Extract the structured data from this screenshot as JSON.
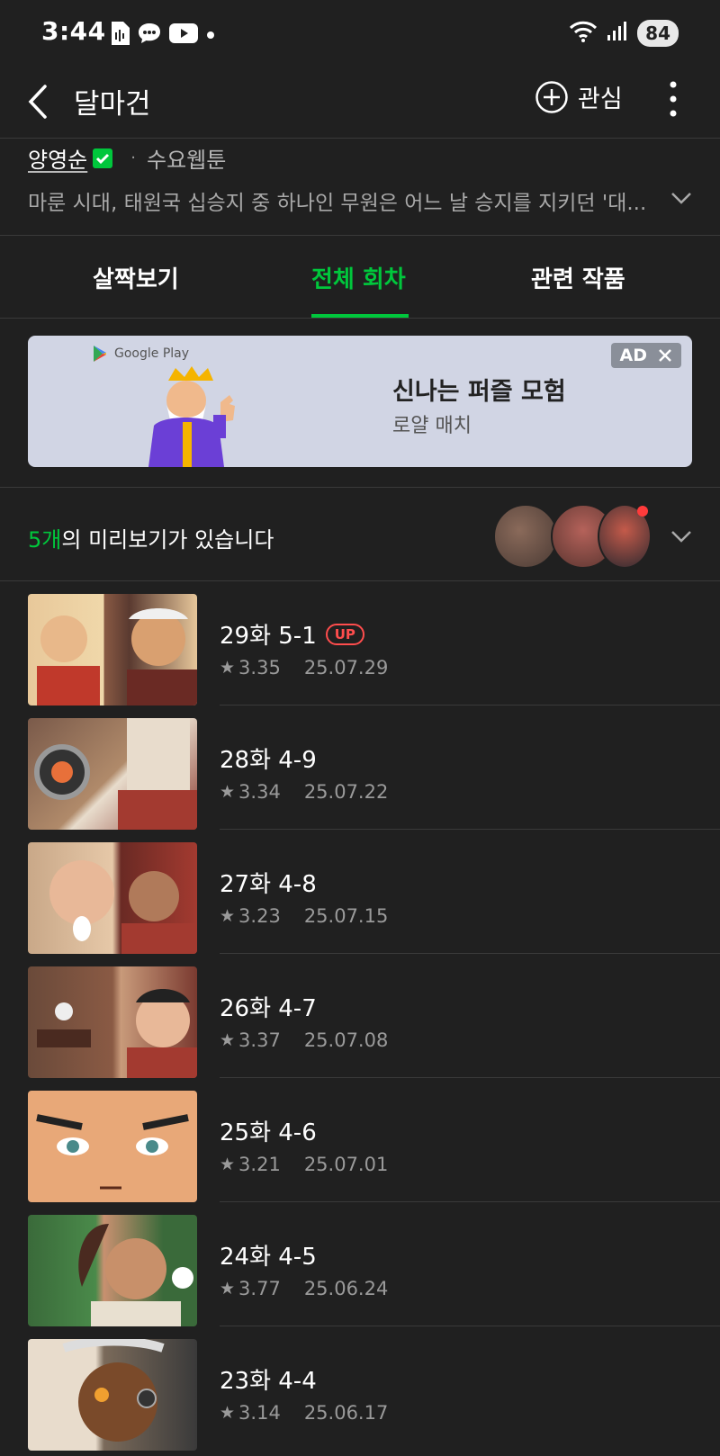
{
  "status_bar": {
    "time": "3:44",
    "battery": "84",
    "notification_icons": [
      "voice-recorder-icon",
      "chat-icon",
      "youtube-icon",
      "dot-icon"
    ],
    "system_icons": [
      "wifi-icon",
      "signal-icon"
    ]
  },
  "header": {
    "title": "달마건",
    "favorite_label": "관심"
  },
  "info": {
    "author": "양영순",
    "day": "수요웹툰",
    "separator": "·",
    "synopsis": "마룬 시대, 태원국 십승지 중 하나인 무원은 어느 날 승지를 지키던 '대..."
  },
  "tabs": [
    {
      "label": "살짝보기",
      "active": false
    },
    {
      "label": "전체 회차",
      "active": true
    },
    {
      "label": "관련 작품",
      "active": false
    }
  ],
  "ad": {
    "store": "Google Play",
    "headline": "신나는 퍼즐 모험",
    "subtitle": "로얄 매치",
    "badge": "AD"
  },
  "preview": {
    "count": "5개",
    "text": "의 미리보기가 있습니다"
  },
  "episodes": [
    {
      "title": "29화 5-1",
      "rating": "3.35",
      "date": "25.07.29",
      "up": "UP"
    },
    {
      "title": "28화 4-9",
      "rating": "3.34",
      "date": "25.07.22"
    },
    {
      "title": "27화 4-8",
      "rating": "3.23",
      "date": "25.07.15"
    },
    {
      "title": "26화 4-7",
      "rating": "3.37",
      "date": "25.07.08"
    },
    {
      "title": "25화 4-6",
      "rating": "3.21",
      "date": "25.07.01"
    },
    {
      "title": "24화 4-5",
      "rating": "3.77",
      "date": "25.06.24"
    },
    {
      "title": "23화 4-4",
      "rating": "3.14",
      "date": "25.06.17"
    }
  ],
  "colors": {
    "accent_green": "#00c73c",
    "background": "#202020",
    "up_badge": "#ff4d4d"
  }
}
